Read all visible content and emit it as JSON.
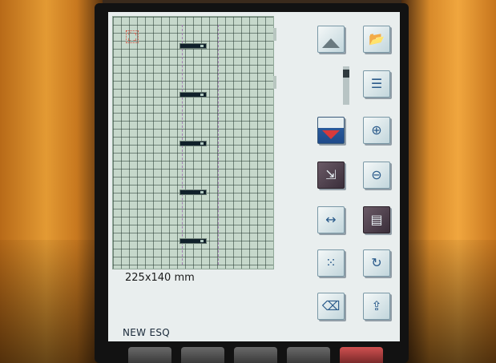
{
  "pattern": {
    "size_label": "225x140 mm"
  },
  "status": {
    "label": "NEW ESQ"
  },
  "icons": {
    "start_point": "start-point-icon",
    "page_up": "triangle-up-icon",
    "open_file": "folder-open-icon",
    "list_view": "list-icon",
    "page_down": "triangle-down-icon",
    "zoom_in": "zoom-in-icon",
    "move_pattern": "move-icon",
    "zoom_out": "zoom-out-icon",
    "width_adjust": "width-arrows-icon",
    "memory": "memory-icon",
    "stitch_grid": "grid-points-icon",
    "rotate": "rotate-icon",
    "erase": "eraser-icon",
    "save": "save-icon"
  },
  "slider": {
    "position": 0.1
  },
  "colors": {
    "grid_background": "#c6d8cb",
    "screen_background": "#e9eeee",
    "accent_blue": "#2a5a9a",
    "accent_red": "#d83a3a"
  }
}
